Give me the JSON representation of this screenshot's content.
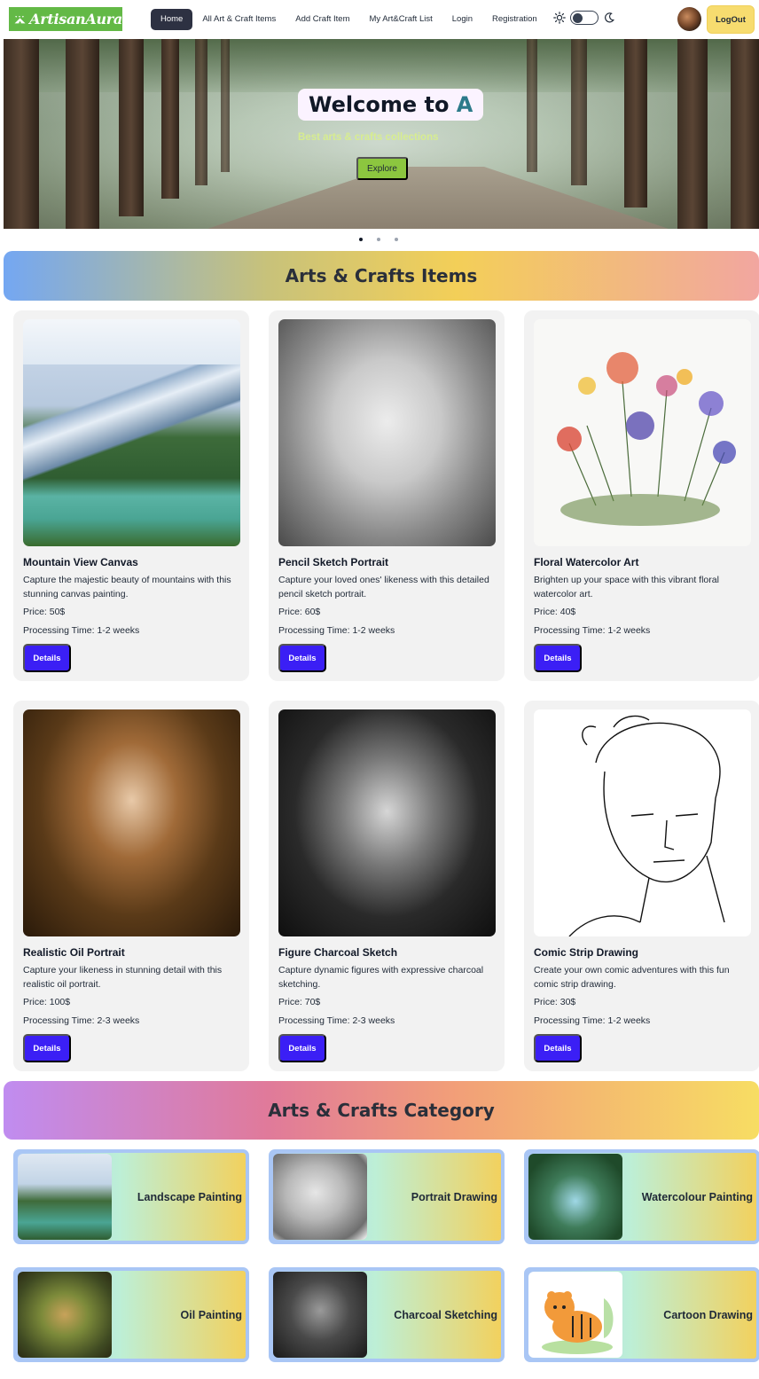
{
  "nav": {
    "logo_text": "ArtisanAura",
    "links": [
      {
        "label": "Home",
        "active": true
      },
      {
        "label": "All Art & Craft Items",
        "active": false
      },
      {
        "label": "Add Craft Item",
        "active": false
      },
      {
        "label": "My Art&Craft List",
        "active": false
      },
      {
        "label": "Login",
        "active": false
      },
      {
        "label": "Registration",
        "active": false
      }
    ],
    "logout_label": "LogOut",
    "icons": {
      "sun": "sun-icon",
      "moon": "moon-icon",
      "avatar": "user-avatar"
    }
  },
  "hero": {
    "title_prefix": "Welcome to ",
    "title_accent": "A",
    "subtitle": "Best arts & crafts collections",
    "cta_label": "Explore",
    "slide_count": 3,
    "active_slide": 1
  },
  "items_section": {
    "title": "Arts & Crafts Items",
    "details_label": "Details",
    "items": [
      {
        "name": "Mountain View Canvas",
        "description": "Capture the majestic beauty of mountains with this stunning canvas painting.",
        "price": "Price: 50$",
        "processing": "Processing Time: 1-2 weeks",
        "art": "mountain"
      },
      {
        "name": "Pencil Sketch Portrait",
        "description": "Capture your loved ones' likeness with this detailed pencil sketch portrait.",
        "price": "Price: 60$",
        "processing": "Processing Time: 1-2 weeks",
        "art": "sketch"
      },
      {
        "name": "Floral Watercolor Art",
        "description": "Brighten up your space with this vibrant floral watercolor art.",
        "price": "Price: 40$",
        "processing": "Processing Time: 1-2 weeks",
        "art": "floral"
      },
      {
        "name": "Realistic Oil Portrait",
        "description": "Capture your likeness in stunning detail with this realistic oil portrait.",
        "price": "Price: 100$",
        "processing": "Processing Time: 2-3 weeks",
        "art": "oil"
      },
      {
        "name": "Figure Charcoal Sketch",
        "description": "Capture dynamic figures with expressive charcoal sketching.",
        "price": "Price: 70$",
        "processing": "Processing Time: 2-3 weeks",
        "art": "charcoal"
      },
      {
        "name": "Comic Strip Drawing",
        "description": "Create your own comic adventures with this fun comic strip drawing.",
        "price": "Price: 30$",
        "processing": "Processing Time: 1-2 weeks",
        "art": "comic"
      }
    ]
  },
  "category_section": {
    "title": "Arts & Crafts Category",
    "categories": [
      {
        "label": "Landscape Painting"
      },
      {
        "label": "Portrait Drawing"
      },
      {
        "label": "Watercolour Painting"
      },
      {
        "label": "Oil Painting"
      },
      {
        "label": "Charcoal Sketching"
      },
      {
        "label": "Cartoon Drawing"
      }
    ]
  },
  "colors": {
    "nav_active": "#2d3142",
    "logout_bg": "#f7dc6f",
    "details_btn": "#3b1ff5",
    "explore_btn": "#8cc63f",
    "logo_bg": "#63b946"
  }
}
